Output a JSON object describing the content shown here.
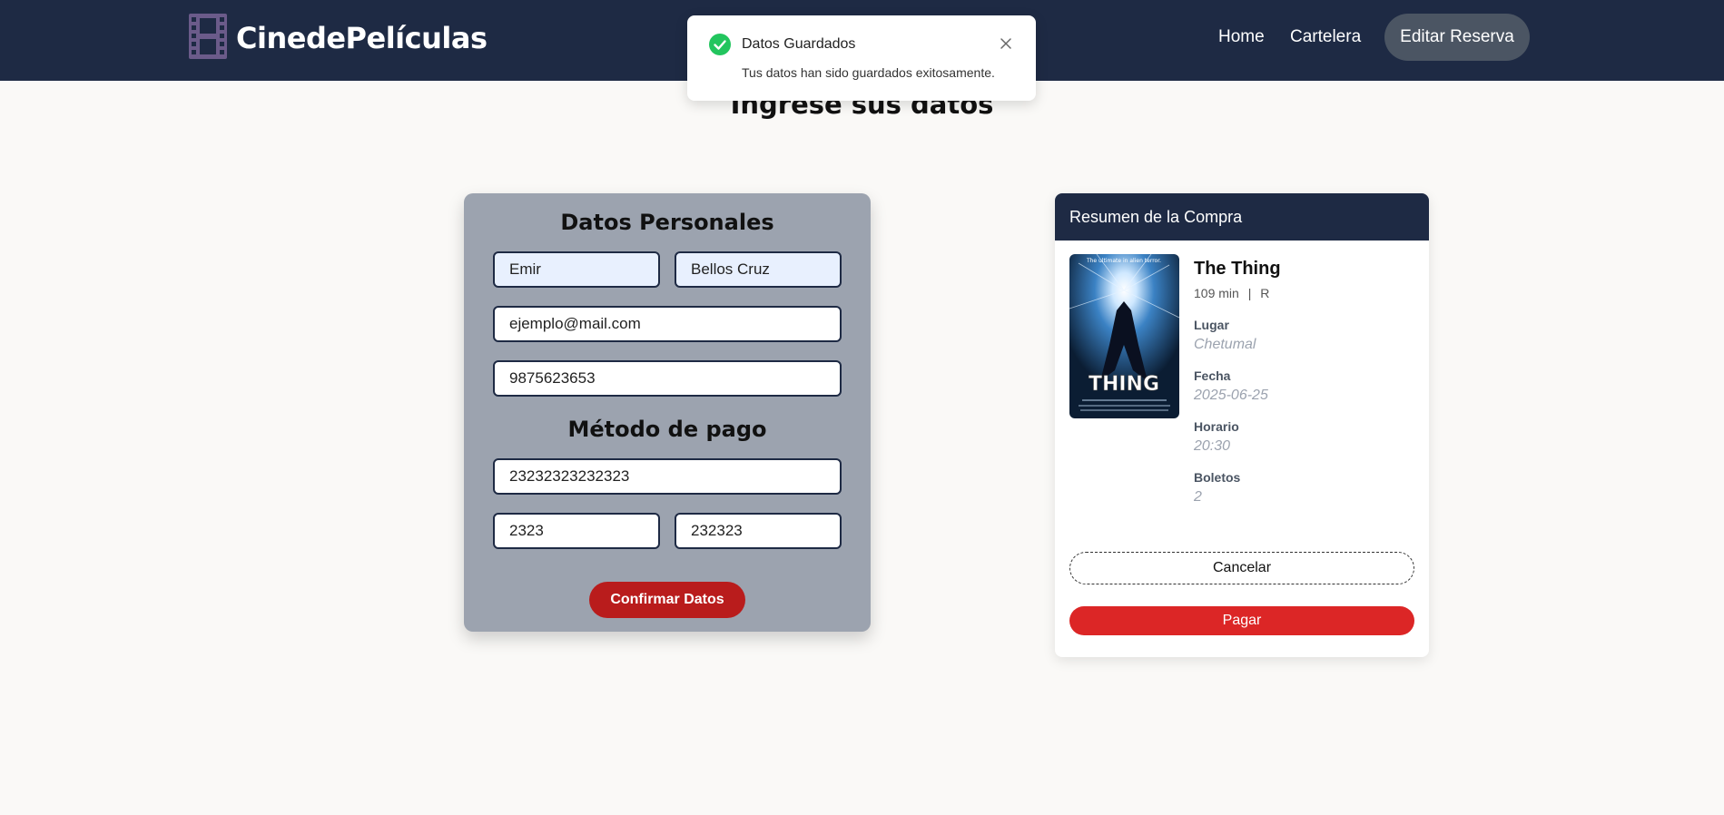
{
  "nav": {
    "brand": "CinedePelículas",
    "home": "Home",
    "cartelera": "Cartelera",
    "edit_button": "Editar Reserva"
  },
  "toast": {
    "title": "Datos Guardados",
    "message": "Tus datos han sido guardados exitosamente."
  },
  "page": {
    "heading": "Ingrese sus datos"
  },
  "form": {
    "personal_title": "Datos Personales",
    "first_name": "Emir",
    "last_name": "Bellos Cruz",
    "email": "ejemplo@mail.com",
    "phone": "9875623653",
    "payment_title": "Método de pago",
    "card_number": "23232323232323",
    "expiry": "2323",
    "cvv": "232323",
    "confirm_button": "Confirmar Datos"
  },
  "summary": {
    "title": "Resumen de la Compra",
    "movie_title": "The Thing",
    "duration": "109 min",
    "rating": "R",
    "poster_tagline": "The ultimate in alien terror.",
    "poster_title": "THING",
    "labels": {
      "place": "Lugar",
      "date": "Fecha",
      "time": "Horario",
      "tickets": "Boletos"
    },
    "values": {
      "place": "Chetumal",
      "date": "2025-06-25",
      "time": "20:30",
      "tickets": "2"
    },
    "cancel_button": "Cancelar",
    "pay_button": "Pagar"
  },
  "colors": {
    "navbar": "#1e2a44",
    "form_card": "#9ca3af",
    "confirm": "#b91c1c",
    "pay": "#dc2626",
    "success": "#22c55e",
    "logo": "#6b5b8a"
  },
  "icons": {
    "logo": "film-icon",
    "toast_status": "check-circle-icon",
    "toast_close": "close-icon"
  }
}
